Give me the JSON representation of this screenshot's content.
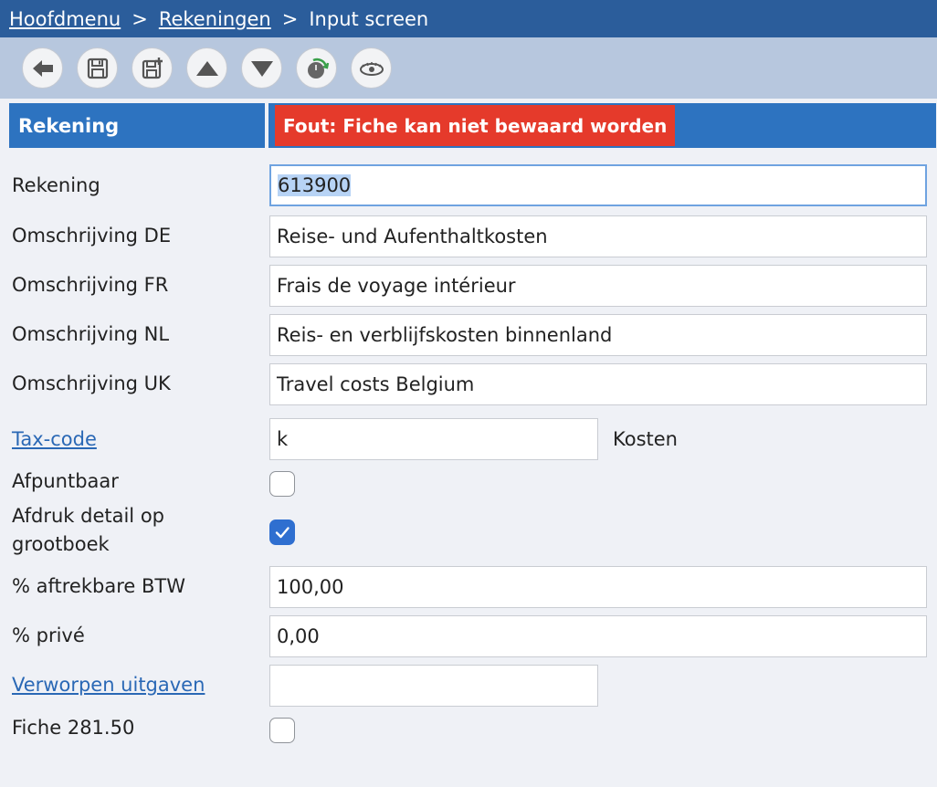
{
  "breadcrumb": {
    "items": [
      "Hoofdmenu",
      "Rekeningen"
    ],
    "separator": ">",
    "current": "Input screen"
  },
  "toolbar": {
    "buttons": [
      "back-icon",
      "save-icon",
      "save-new-icon",
      "arrow-up-icon",
      "arrow-down-icon",
      "refresh-icon",
      "eye-icon"
    ]
  },
  "section": {
    "title": "Rekening",
    "error": "Fout: Fiche kan niet bewaard worden"
  },
  "form": {
    "rekening": {
      "label": "Rekening",
      "value": "613900"
    },
    "omschrijving_de": {
      "label": "Omschrijving DE",
      "value": "Reise- und Aufenthaltkosten"
    },
    "omschrijving_fr": {
      "label": "Omschrijving FR",
      "value": "Frais de voyage intérieur"
    },
    "omschrijving_nl": {
      "label": "Omschrijving NL",
      "value": "Reis- en verblijfskosten binnenland"
    },
    "omschrijving_uk": {
      "label": "Omschrijving UK",
      "value": "Travel costs Belgium"
    },
    "tax_code": {
      "label": "Tax-code",
      "value": "k",
      "description": "Kosten"
    },
    "afpuntbaar": {
      "label": "Afpuntbaar",
      "checked": false
    },
    "afdruk_detail": {
      "label_line1": "Afdruk detail op",
      "label_line2": "grootboek",
      "checked": true
    },
    "aftrekbare_btw": {
      "label": "% aftrekbare BTW",
      "value": "100,00"
    },
    "prive": {
      "label": "% privé",
      "value": "0,00"
    },
    "verworpen_uitgaven": {
      "label": "Verworpen uitgaven",
      "value": ""
    },
    "fiche_281_50": {
      "label": "Fiche 281.50",
      "checked": false
    }
  },
  "colors": {
    "breadcrumb_bar": "#2b5d9b",
    "toolbar": "#b7c7de",
    "section_header": "#2d73c0",
    "error": "#e53a2b",
    "link": "#2a68b5",
    "checkbox_checked": "#2f6fd0"
  }
}
